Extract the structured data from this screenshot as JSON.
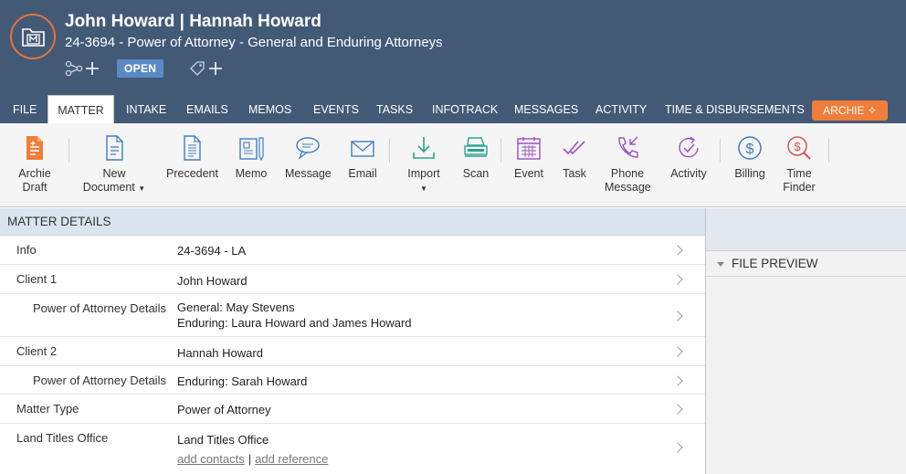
{
  "header": {
    "title": "John Howard | Hannah Howard",
    "subtitle": "24-3694 - Power of Attorney - General and Enduring Attorneys",
    "status": "OPEN"
  },
  "tabs": [
    "FILE",
    "MATTER",
    "INTAKE",
    "EMAILS",
    "MEMOS",
    "EVENTS",
    "TASKS",
    "INFOTRACK",
    "MESSAGES",
    "ACTIVITY",
    "TIME & DISBURSEMENTS"
  ],
  "active_tab": "MATTER",
  "archie_tab": "ARCHIE",
  "ribbon": {
    "archie_draft": [
      "Archie",
      "Draft"
    ],
    "new_document": [
      "New",
      "Document"
    ],
    "precedent": "Precedent",
    "memo": "Memo",
    "message": "Message",
    "email": "Email",
    "import": "Import",
    "scan": "Scan",
    "event": "Event",
    "task": "Task",
    "phone_message": [
      "Phone",
      "Message"
    ],
    "activity": "Activity",
    "billing": "Billing",
    "time_finder": [
      "Time",
      "Finder"
    ]
  },
  "details": {
    "section_title": "MATTER DETAILS",
    "rows": [
      {
        "label": "Info",
        "value": "24-3694 - LA"
      },
      {
        "label": "Client 1",
        "value": "John Howard"
      },
      {
        "label": "Power of Attorney Details",
        "value": "General: May Stevens",
        "value2": "Enduring: Laura Howard and James Howard"
      },
      {
        "label": "Client 2",
        "value": "Hannah Howard"
      },
      {
        "label": "Power of Attorney Details",
        "value": "Enduring: Sarah Howard"
      },
      {
        "label": "Matter Type",
        "value": "Power of Attorney"
      },
      {
        "label": "Land Titles Office",
        "value": "Land Titles Office",
        "link1": "add contacts",
        "separator": "|",
        "link2": "add reference"
      }
    ]
  },
  "side": {
    "preview_title": "FILE PREVIEW"
  },
  "colors": {
    "header_bg": "#435a77",
    "accent_orange": "#f07d3a",
    "status_badge": "#5a8bc5",
    "section_head_bg": "#d9e4ef",
    "icon_blue": "#3f7fc1",
    "icon_teal": "#2aa58f",
    "icon_purple": "#9b4fc2",
    "icon_red": "#d9534f"
  }
}
